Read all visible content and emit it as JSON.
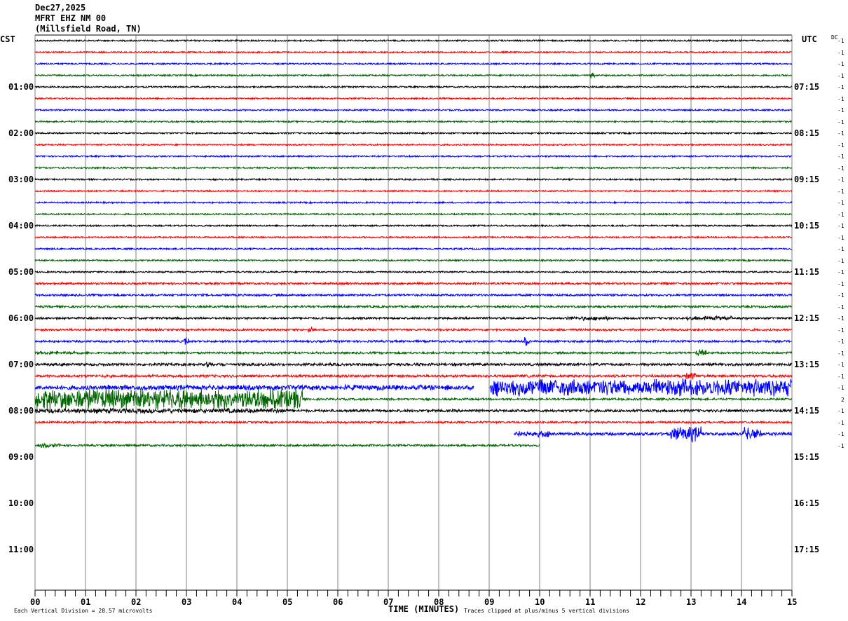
{
  "chart_data": {
    "type": "line",
    "title": [
      "Dec27,2025",
      "MFRT EHZ NM 00",
      "(Millsfield Road, TN)"
    ],
    "left_timezone": "CST",
    "right_timezone": "UTC",
    "dc_label": "DC",
    "left_hour_labels": [
      "01:00",
      "02:00",
      "03:00",
      "04:00",
      "05:00",
      "06:00",
      "07:00",
      "08:00",
      "09:00",
      "10:00",
      "11:00"
    ],
    "right_hour_labels": [
      "07:15",
      "08:15",
      "09:15",
      "10:15",
      "11:15",
      "12:15",
      "13:15",
      "14:15",
      "15:15",
      "16:15",
      "17:15"
    ],
    "x_ticks": [
      "00",
      "01",
      "02",
      "03",
      "04",
      "05",
      "06",
      "07",
      "08",
      "09",
      "10",
      "11",
      "12",
      "13",
      "14",
      "15"
    ],
    "xlabel": "TIME (MINUTES)",
    "xlim": [
      0,
      15
    ],
    "rows_total": 48,
    "colors": [
      "#000000",
      "#ff0000",
      "#0000ff",
      "#006400"
    ],
    "dc_values": [
      "-1",
      "-1",
      "-1",
      "-1",
      "-1",
      "-1",
      "-1",
      "-1",
      "-1",
      "-1",
      "-1",
      "-1",
      "-1",
      "-1",
      "-1",
      "-1",
      "-1",
      "-1",
      "-1",
      "-1",
      "-1",
      "-1",
      "-1",
      "-1",
      "-1",
      "-1",
      "-1",
      "-1",
      "-1",
      "-1",
      "-1",
      "2",
      "-1",
      "-1",
      "-1",
      "-1"
    ],
    "scale_note": "Each Vertical Division =   28.57 microvolts",
    "clip_note": "Traces clipped at plus/minus 5 vertical divisions",
    "traces": [
      {
        "row": 0,
        "start": 0,
        "end": 15,
        "amp": 0.3,
        "bursts": []
      },
      {
        "row": 1,
        "start": 0,
        "end": 15,
        "amp": 0.3,
        "bursts": []
      },
      {
        "row": 2,
        "start": 0,
        "end": 15,
        "amp": 0.3,
        "bursts": []
      },
      {
        "row": 3,
        "start": 0,
        "end": 15,
        "amp": 0.3,
        "bursts": [
          [
            11,
            11.1,
            1.2
          ]
        ]
      },
      {
        "row": 4,
        "start": 0,
        "end": 15,
        "amp": 0.3,
        "bursts": []
      },
      {
        "row": 5,
        "start": 0,
        "end": 15,
        "amp": 0.3,
        "bursts": []
      },
      {
        "row": 6,
        "start": 0,
        "end": 15,
        "amp": 0.3,
        "bursts": []
      },
      {
        "row": 7,
        "start": 0,
        "end": 15,
        "amp": 0.3,
        "bursts": []
      },
      {
        "row": 8,
        "start": 0,
        "end": 15,
        "amp": 0.3,
        "bursts": []
      },
      {
        "row": 9,
        "start": 0,
        "end": 15,
        "amp": 0.3,
        "bursts": []
      },
      {
        "row": 10,
        "start": 0,
        "end": 15,
        "amp": 0.3,
        "bursts": []
      },
      {
        "row": 11,
        "start": 0,
        "end": 15,
        "amp": 0.3,
        "bursts": []
      },
      {
        "row": 12,
        "start": 0,
        "end": 15,
        "amp": 0.3,
        "bursts": []
      },
      {
        "row": 13,
        "start": 0,
        "end": 15,
        "amp": 0.3,
        "bursts": []
      },
      {
        "row": 14,
        "start": 0,
        "end": 15,
        "amp": 0.3,
        "bursts": []
      },
      {
        "row": 15,
        "start": 0,
        "end": 15,
        "amp": 0.3,
        "bursts": []
      },
      {
        "row": 16,
        "start": 0,
        "end": 15,
        "amp": 0.3,
        "bursts": []
      },
      {
        "row": 17,
        "start": 0,
        "end": 15,
        "amp": 0.3,
        "bursts": []
      },
      {
        "row": 18,
        "start": 0,
        "end": 15,
        "amp": 0.3,
        "bursts": []
      },
      {
        "row": 19,
        "start": 0,
        "end": 15,
        "amp": 0.3,
        "bursts": []
      },
      {
        "row": 20,
        "start": 0,
        "end": 15,
        "amp": 0.3,
        "bursts": []
      },
      {
        "row": 21,
        "start": 0,
        "end": 15,
        "amp": 0.4,
        "bursts": [
          [
            12,
            15,
            0.4
          ]
        ]
      },
      {
        "row": 22,
        "start": 0,
        "end": 15,
        "amp": 0.4,
        "bursts": []
      },
      {
        "row": 23,
        "start": 0,
        "end": 15,
        "amp": 0.4,
        "bursts": []
      },
      {
        "row": 24,
        "start": 0,
        "end": 15,
        "amp": 0.4,
        "bursts": [
          [
            10.5,
            11.4,
            1.0
          ],
          [
            12.9,
            13.8,
            1.0
          ]
        ]
      },
      {
        "row": 25,
        "start": 0,
        "end": 15,
        "amp": 0.4,
        "bursts": [
          [
            5.4,
            5.5,
            1.2
          ]
        ]
      },
      {
        "row": 26,
        "start": 0,
        "end": 15,
        "amp": 0.4,
        "bursts": [
          [
            2.95,
            3.05,
            1.5
          ],
          [
            9.7,
            9.8,
            2
          ]
        ]
      },
      {
        "row": 27,
        "start": 0,
        "end": 15,
        "amp": 0.4,
        "bursts": [
          [
            0,
            1,
            0.8
          ],
          [
            13.1,
            13.3,
            1.5
          ]
        ]
      },
      {
        "row": 28,
        "start": 0,
        "end": 15,
        "amp": 0.5,
        "bursts": [
          [
            0,
            15,
            0.4
          ],
          [
            3.4,
            3.5,
            1.5
          ]
        ]
      },
      {
        "row": 29,
        "start": 0,
        "end": 15,
        "amp": 0.5,
        "bursts": [
          [
            9.5,
            15,
            0.6
          ],
          [
            12.9,
            13.1,
            2
          ]
        ]
      },
      {
        "row": 30,
        "start": 0,
        "end": 15,
        "amp": 0.8,
        "bursts": [
          [
            1.3,
            8.7,
            1.2
          ],
          [
            9,
            15,
            4
          ]
        ],
        "gaps": [
          [
            8.7,
            9.0
          ]
        ]
      },
      {
        "row": 31,
        "start": 0,
        "end": 15,
        "amp": 0.4,
        "bursts": [
          [
            0,
            5.3,
            5
          ]
        ]
      },
      {
        "row": 32,
        "start": 0,
        "end": 15,
        "amp": 0.5,
        "bursts": [
          [
            0,
            5,
            1.2
          ]
        ]
      },
      {
        "row": 33,
        "start": 0,
        "end": 15,
        "amp": 0.4,
        "bursts": []
      },
      {
        "row": 34,
        "start": 9.5,
        "end": 15,
        "amp": 0.6,
        "bursts": [
          [
            9.5,
            10.2,
            1.5
          ],
          [
            12.6,
            13.2,
            3.5
          ],
          [
            14,
            14.4,
            3
          ]
        ]
      },
      {
        "row": 35,
        "start": 0,
        "end": 10,
        "amp": 0.4,
        "bursts": [
          [
            0.1,
            0.5,
            1
          ]
        ]
      }
    ]
  }
}
